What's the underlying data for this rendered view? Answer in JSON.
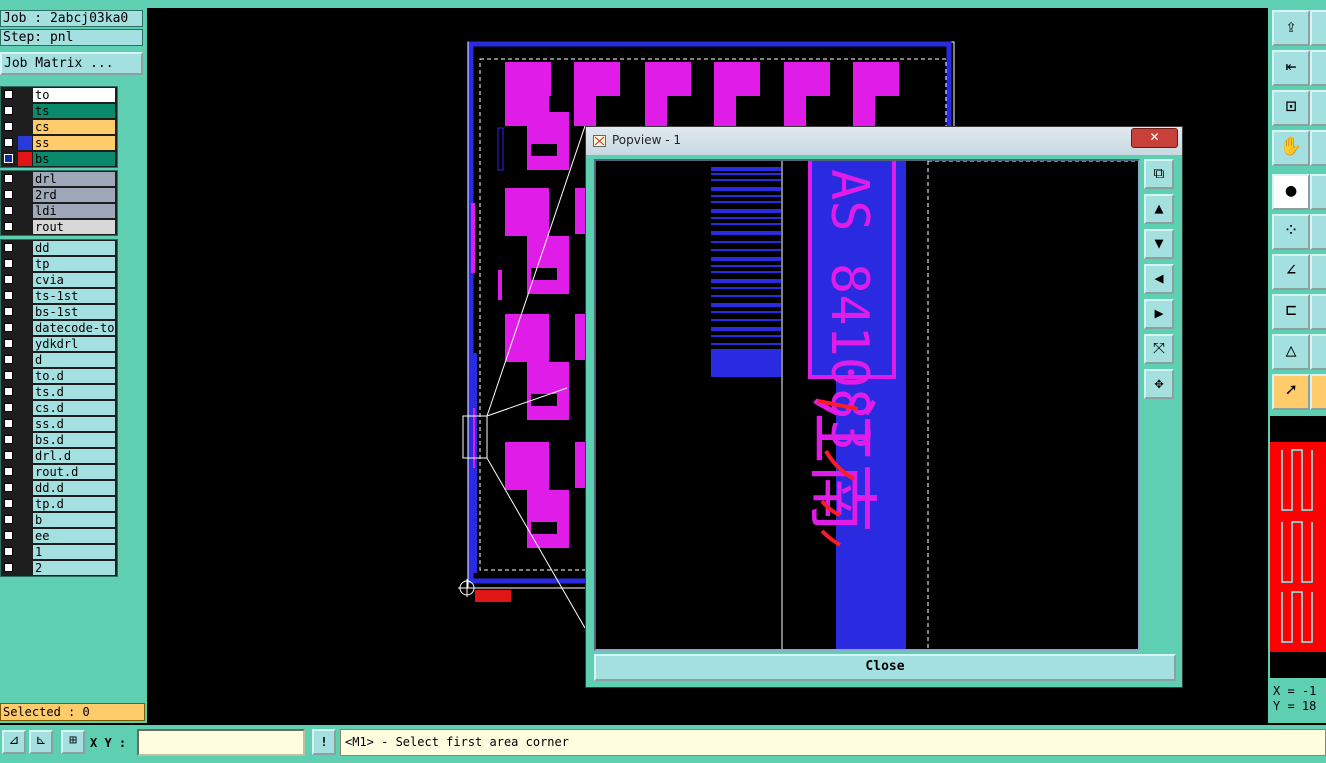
{
  "job": {
    "label": "Job : 2abcj03ka0",
    "step": "Step: pnl",
    "matrix_button": "Job Matrix ..."
  },
  "layers": {
    "group1": [
      {
        "name": "to",
        "bg": "#ffffff",
        "checked": false,
        "swatch": ""
      },
      {
        "name": "ts",
        "bg": "#0a8a6a",
        "checked": false,
        "swatch": ""
      },
      {
        "name": "cs",
        "bg": "#ffcb6b",
        "checked": false,
        "swatch": ""
      },
      {
        "name": "ss",
        "bg": "#ffcb6b",
        "checked": false,
        "swatch": "#2a3ad8"
      },
      {
        "name": "bs",
        "bg": "#0a8a6a",
        "checked": true,
        "swatch": "#e01616"
      }
    ],
    "group2": [
      {
        "name": "drl",
        "bg": "#9ea8b8"
      },
      {
        "name": "2rd",
        "bg": "#9ea8b8"
      },
      {
        "name": "ldi",
        "bg": "#9ea8b8"
      },
      {
        "name": "rout",
        "bg": "#d8d8d8"
      }
    ],
    "group3": [
      "dd",
      "tp",
      "cvia",
      "ts-1st",
      "bs-1st",
      "datecode-to",
      "ydkdrl",
      "d",
      "to.d",
      "ts.d",
      "cs.d",
      "ss.d",
      "bs.d",
      "drl.d",
      "rout.d",
      "dd.d",
      "tp.d",
      "b",
      "ee",
      "1",
      "2"
    ]
  },
  "selected": "Selected : 0",
  "xy_label": "X Y :",
  "status_message": "<M1> - Select first area corner",
  "coords": {
    "x": "X = -1",
    "y": "Y = 18"
  },
  "popview": {
    "title": "Popview - 1",
    "close_x": "✕",
    "close_button": "Close",
    "vertical_text": "AS 841083",
    "chinese_text": "江南"
  },
  "colors": {
    "panel": "#5fcfb1",
    "button": "#a3e0df",
    "pad": "#e01ce8",
    "copper_blue": "#2a2ae0",
    "highlight": "#ffcb6b"
  }
}
